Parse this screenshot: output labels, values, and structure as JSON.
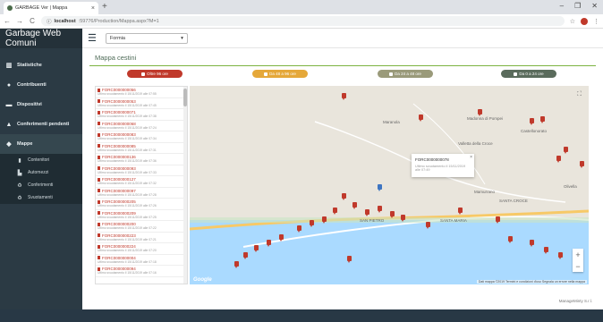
{
  "browser": {
    "tab_title": "GARBAGE Ver | Mappa",
    "url_host": "localhost",
    "url_path": ":59776/Production/Mappa.aspx?M=1"
  },
  "app": {
    "brand": "Garbage Web Comuni",
    "comune_selected": "Formia",
    "version": "ManageMinty S.r.l."
  },
  "sidebar": {
    "items": [
      {
        "label": "Statistiche",
        "icon": "chart-icon"
      },
      {
        "label": "Contribuenti",
        "icon": "user-icon"
      },
      {
        "label": "Dispositivi",
        "icon": "device-icon"
      },
      {
        "label": "Conferimenti pendenti",
        "icon": "warning-icon"
      },
      {
        "label": "Mappe",
        "icon": "map-marker-icon"
      }
    ],
    "submenu": [
      {
        "label": "Contenitori",
        "icon": "bin-icon"
      },
      {
        "label": "Automezzi",
        "icon": "truck-icon"
      },
      {
        "label": "Conferimenti",
        "icon": "recycle-icon"
      },
      {
        "label": "Svuotamenti",
        "icon": "recycle-icon"
      }
    ]
  },
  "panel": {
    "title": "Mappa cestini",
    "legend": [
      {
        "label": "Oltre 96 ore",
        "color": "#c0392b"
      },
      {
        "label": "Da 48 a 96 ore",
        "color": "#e5a83a"
      },
      {
        "label": "Da 24 a 48 ore",
        "color": "#9a9a7a"
      },
      {
        "label": "Da 0 a 24 ore",
        "color": "#5a6b5c"
      }
    ]
  },
  "list": [
    {
      "code": "FORC0000000056",
      "sub": "Ultimo svuotamento il 15/11/2019 alle 07:55"
    },
    {
      "code": "FORC0000000053",
      "sub": "Ultimo svuotamento il 15/11/2019 alle 07:45"
    },
    {
      "code": "FORC0000000071",
      "sub": "Ultimo svuotamento il 15/11/2019 alle 07:38"
    },
    {
      "code": "FORC0000000068",
      "sub": "Ultimo svuotamento il 15/11/2019 alle 07:24"
    },
    {
      "code": "FORC0000000083",
      "sub": "Ultimo svuotamento il 15/11/2019 alle 07:34"
    },
    {
      "code": "FORC0000000085",
      "sub": "Ultimo svuotamento il 15/11/2019 alle 07:31"
    },
    {
      "code": "FORC0000000136",
      "sub": "Ultimo svuotamento il 15/11/2019 alle 07:36"
    },
    {
      "code": "FORC0000000093",
      "sub": "Ultimo svuotamento il 15/11/2019 alle 07:33"
    },
    {
      "code": "FORC0000000127",
      "sub": "Ultimo svuotamento il 15/11/2019 alle 07:32"
    },
    {
      "code": "FORC0000000097",
      "sub": "Ultimo svuotamento il 15/11/2019 alle 07:28"
    },
    {
      "code": "FORC0000000205",
      "sub": "Ultimo svuotamento il 15/11/2019 alle 07:26"
    },
    {
      "code": "FORC0000000209",
      "sub": "Ultimo svuotamento il 15/11/2019 alle 07:25"
    },
    {
      "code": "FORC0000000200",
      "sub": "Ultimo svuotamento il 15/11/2019 alle 07:22"
    },
    {
      "code": "FORC0000000223",
      "sub": "Ultimo svuotamento il 15/11/2019 alle 07:21"
    },
    {
      "code": "FORC0000000224",
      "sub": "Ultimo svuotamento il 15/11/2019 alle 07:20"
    },
    {
      "code": "FORC0000000004",
      "sub": "Ultimo svuotamento il 15/11/2019 alle 07:18"
    },
    {
      "code": "FORC0000000094",
      "sub": "Ultimo svuotamento il 15/11/2019 alle 07:16"
    }
  ],
  "map": {
    "labels": [
      "Maranola",
      "Madonna di Pompei",
      "Castellonorato",
      "Gianola",
      "Mamurrano",
      "SANTA CROCE",
      "SANTA MARIA",
      "SAN PIETRO",
      "Olivella",
      "Valletta della Croce"
    ],
    "popup_code": "FORC0000000078",
    "popup_date": "Ultimo svuotamento il 15/11/2019 alle 07:49",
    "google": "Google",
    "attribution": "Dati mappa ©2019   Termini e condizioni d'uso   Segnala un errore nella mappa"
  }
}
